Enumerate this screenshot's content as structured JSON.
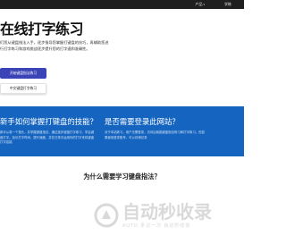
{
  "header": {
    "nav": [
      {
        "label": "产品",
        "has_dropdown": true
      },
      {
        "label": "学练"
      }
    ]
  },
  "hero": {
    "title": "在线打字练习",
    "description": "们您从键盘指法入手，逐步指导您掌握打键盘的技巧，再辅助您进行打字练习和游戏挑战逐步提升您的打字速和准确性。",
    "primary_button": "开始键盘指法练习",
    "secondary_button": "中文键盘打字练习"
  },
  "faq": [
    {
      "question": "新手如何掌握打键盘的技能？",
      "answer": "新手从零一个指头，并掌握键盘指法，通过逐步键盘打字练习，学会键盘打字。加长打字时间，提升速度，并在日常中运用你的打字来将键盘打字技能"
    },
    {
      "question": "是否需要登录此网站？",
      "answer": "对于本站练习，用户无需登录，访问后就能键盘指法练习和打字练习。但如果使用登录账号，可以存储记录"
    }
  ],
  "section": {
    "title": "为什么需要学习键盘指法？"
  },
  "watermark": {
    "main": "自动秒收录",
    "sub": "AUTO   来访一次·自动秒收录"
  },
  "colors": {
    "topbar": "#1f1f1f",
    "primary": "#3b44b7",
    "band": "#1565c0"
  }
}
